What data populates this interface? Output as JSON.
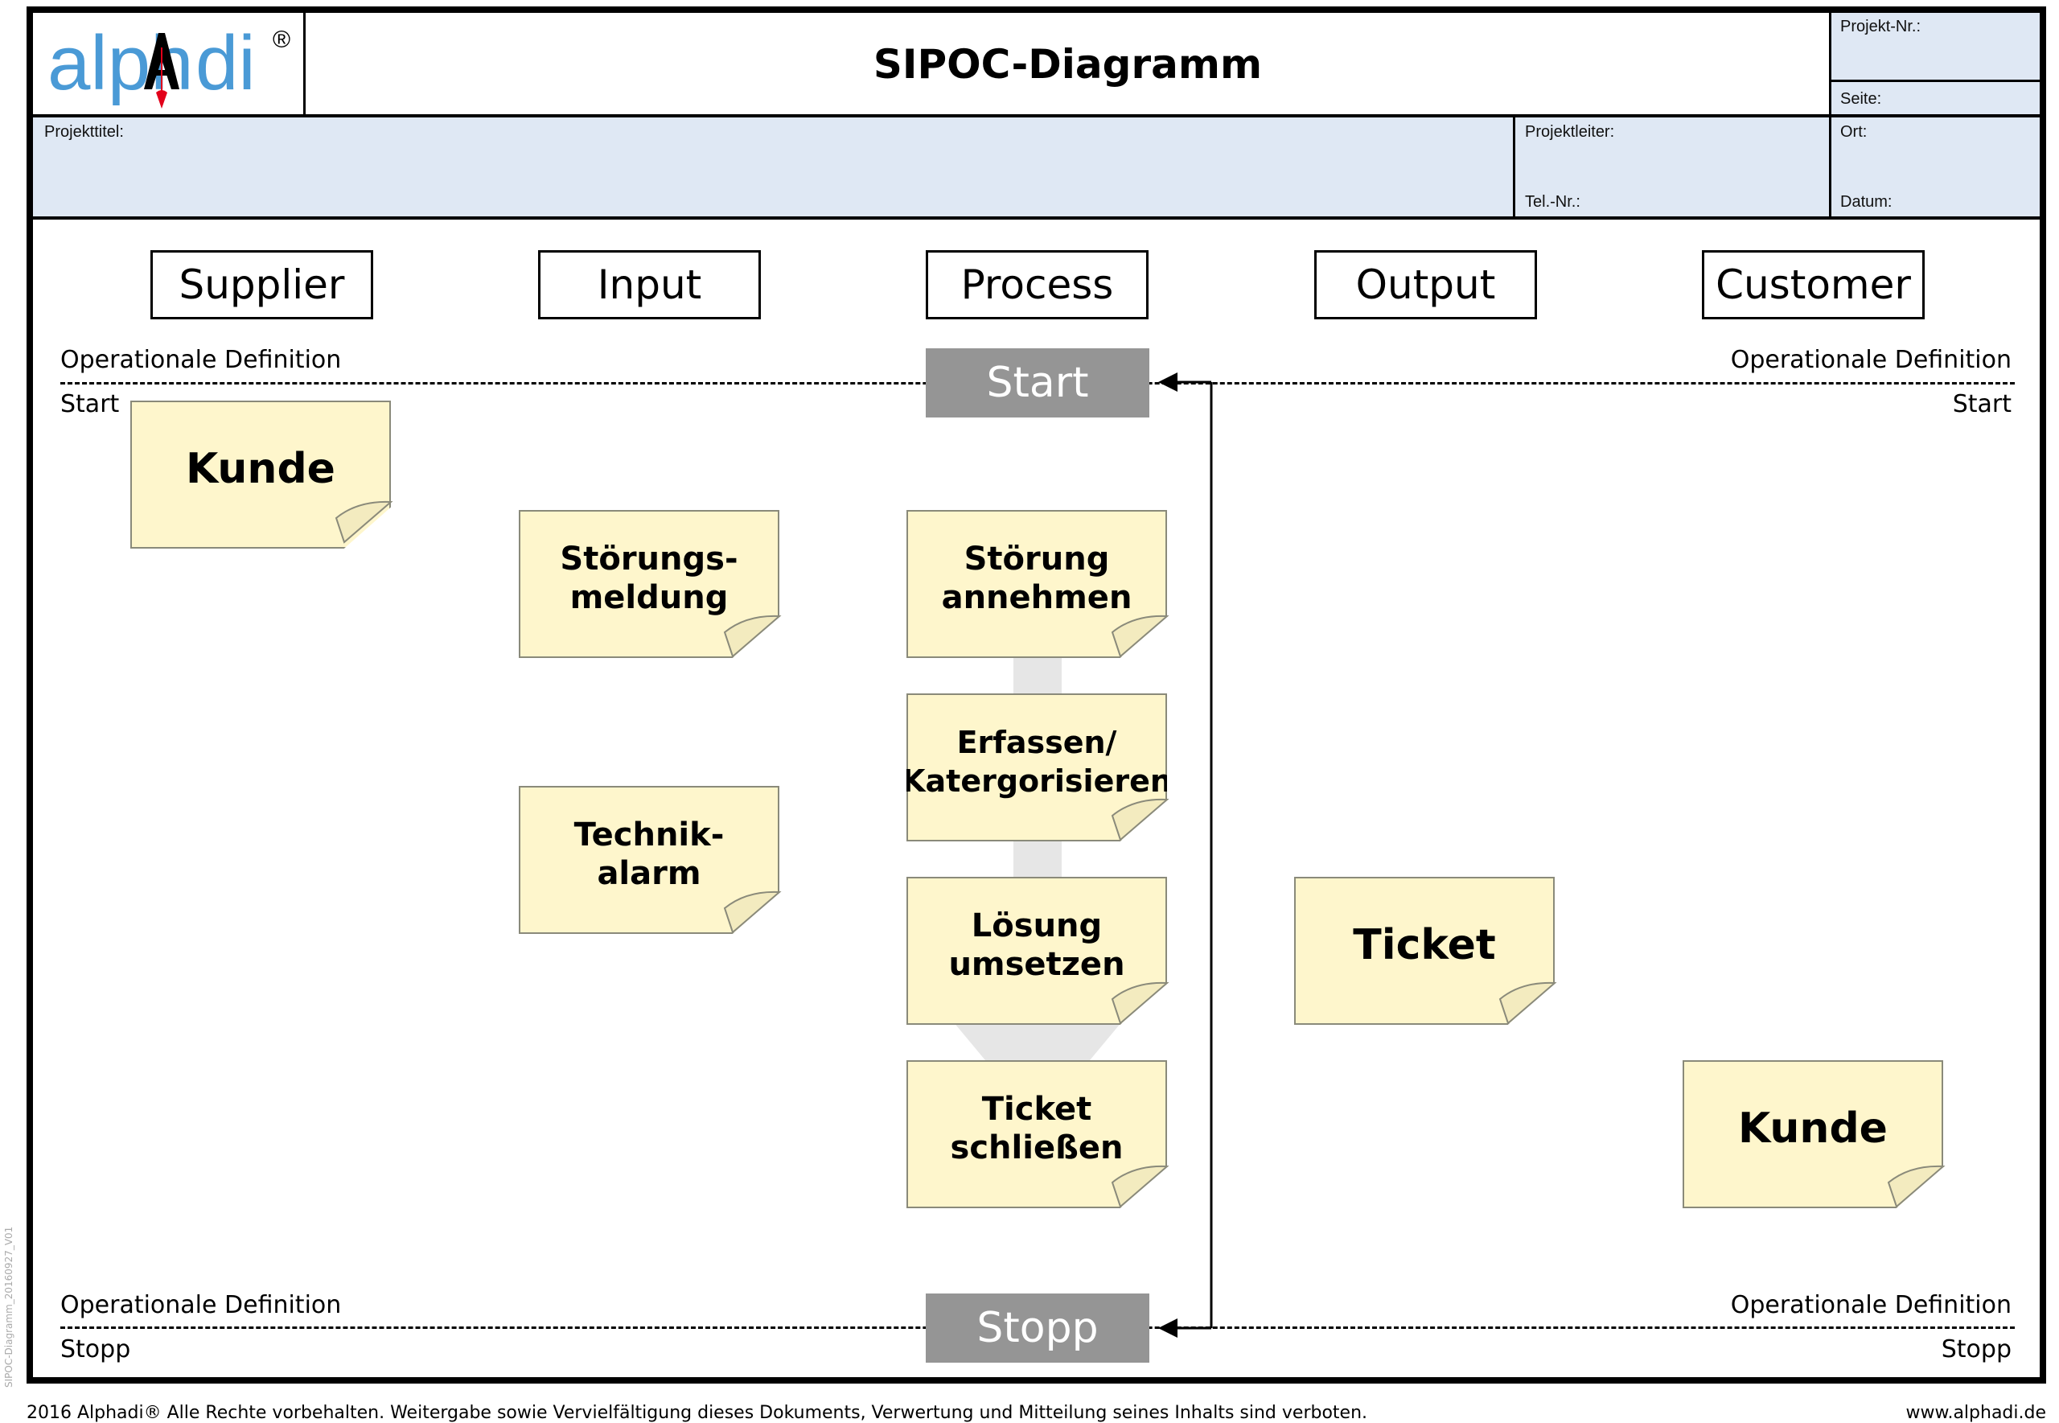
{
  "header": {
    "logo_text": "alphAdi",
    "logo_registered": "®",
    "title": "SIPOC-Diagramm",
    "fields": {
      "projekt_nr": "Projekt-Nr.:",
      "seite": "Seite:",
      "projekttitel": "Projekttitel:",
      "projektleiter": "Projektleiter:",
      "tel_nr": "Tel.-Nr.:",
      "ort": "Ort:",
      "datum": "Datum:"
    }
  },
  "columns": [
    {
      "label": "Supplier"
    },
    {
      "label": "Input"
    },
    {
      "label": "Process"
    },
    {
      "label": "Output"
    },
    {
      "label": "Customer"
    }
  ],
  "boundaries": {
    "start": {
      "box_label": "Start",
      "left_definition": "Operationale Definition",
      "left_sub": "Start",
      "right_definition": "Operationale Definition",
      "right_sub": "Start"
    },
    "stop": {
      "box_label": "Stopp",
      "left_definition": "Operationale Definition",
      "left_sub": "Stopp",
      "right_definition": "Operationale Definition",
      "right_sub": "Stopp"
    }
  },
  "notes": {
    "supplier": [
      {
        "text": "Kunde"
      }
    ],
    "input": [
      {
        "text": "Störungs-\nmeldung"
      },
      {
        "text": "Technik-\nalarm"
      }
    ],
    "process": [
      {
        "text": "Störung\nannehmen"
      },
      {
        "text": "Erfassen/\nKatergorisieren"
      },
      {
        "text": "Lösung\numsetzen"
      },
      {
        "text": "Ticket\nschließen"
      }
    ],
    "output": [
      {
        "text": "Ticket"
      }
    ],
    "customer": [
      {
        "text": "Kunde"
      }
    ]
  },
  "colors": {
    "logo_blue": "#4a9ad6",
    "logo_red": "#e2001a",
    "header_fill": "#dfe8f4",
    "note_fill": "#fef6cc",
    "boundary_box": "#959595"
  },
  "footer": {
    "copyright": "2016 Alphadi® Alle Rechte vorbehalten. Weitergabe sowie Vervielfältigung dieses Dokuments, Verwertung und Mitteilung seines Inhalts sind verboten.",
    "website": "www.alphadi.de",
    "side_label": "SIPOC-Diagramm_20160927_V01"
  }
}
